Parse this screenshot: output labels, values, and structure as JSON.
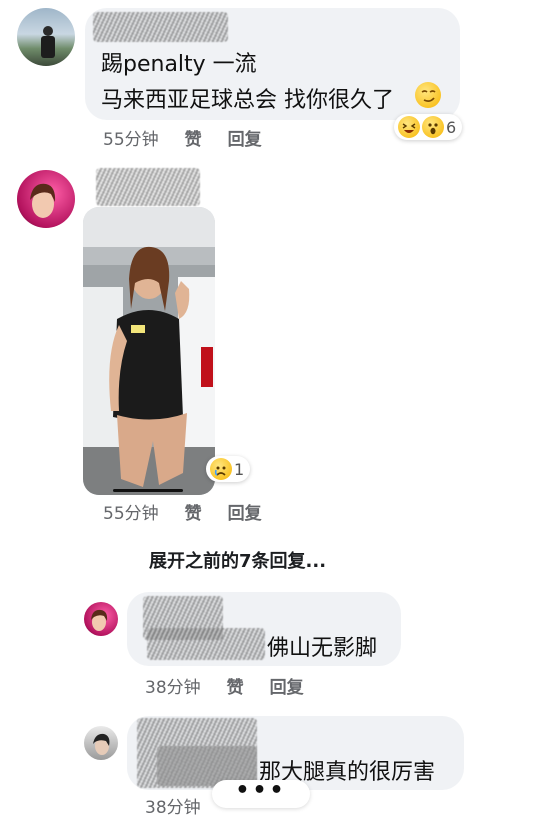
{
  "comments": [
    {
      "line1": "踢penalty 一流",
      "line2": "马来西亚足球总会 找你很久了",
      "time": "55分钟",
      "like": "赞",
      "reply": "回复",
      "reaction_count": "6"
    },
    {
      "time": "55分钟",
      "like": "赞",
      "reply": "回复",
      "reaction_count": "1"
    }
  ],
  "expand_replies": "展开之前的7条回复...",
  "replies": [
    {
      "text": "佛山无影脚",
      "time": "38分钟",
      "like": "赞",
      "reply": "回复"
    },
    {
      "text": "那大腿真的很厉害",
      "time": "38分钟"
    }
  ],
  "typing_indicator": "•••"
}
